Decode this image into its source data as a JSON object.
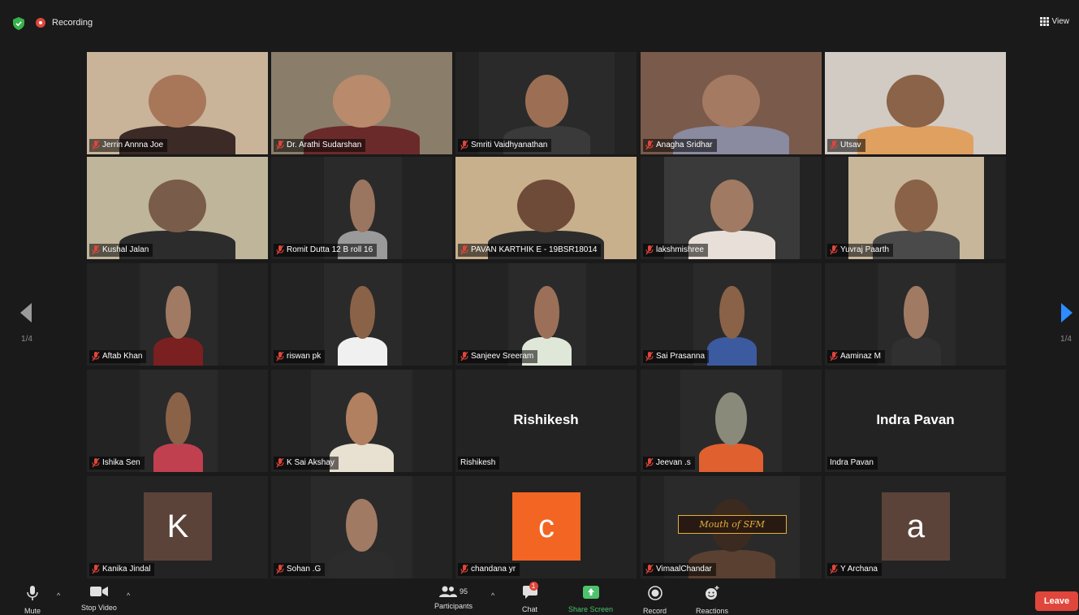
{
  "top": {
    "recording_label": "Recording",
    "view_label": "View"
  },
  "paging": {
    "left": "1/4",
    "right": "1/4"
  },
  "tiles": [
    {
      "name": "Jerrin Annna Joe"
    },
    {
      "name": "Dr. Arathi Sudarshan"
    },
    {
      "name": "Smriti Vaidhyanathan"
    },
    {
      "name": "Anagha Sridhar"
    },
    {
      "name": "Utsav"
    },
    {
      "name": "Kushal Jalan"
    },
    {
      "name": "Romit Dutta 12 B  roll 16"
    },
    {
      "name": "PAVAN KARTHIK E - 19BSR18014"
    },
    {
      "name": "lakshmishree"
    },
    {
      "name": "Yuvraj Paarth"
    },
    {
      "name": "Aftab Khan"
    },
    {
      "name": "riswan pk"
    },
    {
      "name": "Sanjeev Sreeram"
    },
    {
      "name": "Sai Prasanna"
    },
    {
      "name": "Aaminaz M"
    },
    {
      "name": "Ishika Sen"
    },
    {
      "name": "K Sai Akshay"
    },
    {
      "name": "Rishikesh",
      "display": "Rishikesh"
    },
    {
      "name": "Jeevan .s"
    },
    {
      "name": "Indra Pavan",
      "display": "Indra Pavan"
    },
    {
      "name": "Kanika Jindal",
      "avatar": "K"
    },
    {
      "name": "Sohan .G"
    },
    {
      "name": "chandana yr",
      "avatar": "c"
    },
    {
      "name": "VimaalChandar",
      "art_text": "Mouth of SFM"
    },
    {
      "name": "Y Archana",
      "avatar": "a"
    }
  ],
  "toolbar": {
    "mute": "Mute",
    "stop_video": "Stop Video",
    "participants": "Participants",
    "participants_count": "95",
    "chat": "Chat",
    "chat_badge": "1",
    "share_screen": "Share Screen",
    "record": "Record",
    "reactions": "Reactions",
    "leave": "Leave"
  },
  "colors": {
    "accent_green": "#4cc36c",
    "leave_red": "#e0463b",
    "speaker_border": "#d4e157"
  }
}
